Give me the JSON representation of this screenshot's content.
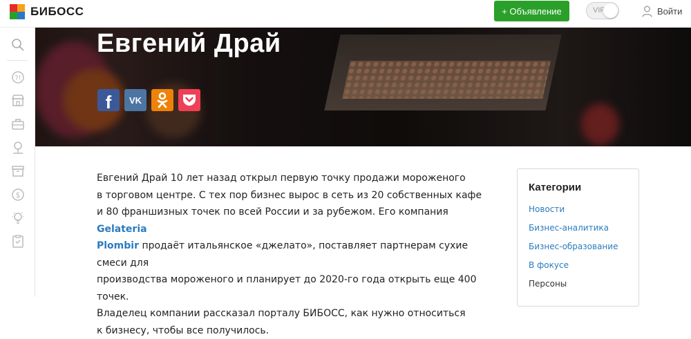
{
  "header": {
    "logo_text": "БИБОСС",
    "logo_colors": [
      "#e52d27",
      "#f7a21b",
      "#2aa02a",
      "#2a7bbf"
    ],
    "post_button": "+ Объявление",
    "vip_label": "VIP",
    "login_label": "Войти"
  },
  "sidebar": {
    "icons": [
      "search-icon",
      "question-icon",
      "store-icon",
      "briefcase-icon",
      "webinar-icon",
      "archive-icon",
      "dollar-icon",
      "idea-icon",
      "checklist-icon"
    ]
  },
  "hero": {
    "title": "Евгений Драй",
    "share": [
      {
        "name": "facebook",
        "symbol": "f",
        "color": "#3b5998"
      },
      {
        "name": "vk",
        "symbol": "VK",
        "color": "#4c75a3"
      },
      {
        "name": "odnoklassniki",
        "symbol": "ok",
        "color": "#ee8208"
      },
      {
        "name": "pocket",
        "symbol": "pocket",
        "color": "#ef4056"
      }
    ]
  },
  "article": {
    "text_before_link": "Евгений Драй 10 лет назад открыл первую точку продажи мороженого\nв торговом центре. С тех пор бизнес вырос в сеть из 20 собственных кафе\nи 80 франшизных точек по всей России и за рубежом. Его компания ",
    "link_text": "Gelateria\nPlombir",
    "text_after_link": " продаёт итальянское «джелато», поставляет партнерам сухие смеси для\nпроизводства мороженого и планирует до 2020-го года открыть еще 400 точек.\nВладелец компании рассказал порталу БИБОСС, как нужно относиться\nк бизнесу, чтобы все получилось."
  },
  "categories": {
    "title": "Категории",
    "items": [
      {
        "label": "Новости",
        "active": false
      },
      {
        "label": "Бизнес-аналитика",
        "active": false
      },
      {
        "label": "Бизнес-образование",
        "active": false
      },
      {
        "label": "В фокусе",
        "active": false
      },
      {
        "label": "Персоны",
        "active": true
      }
    ]
  }
}
